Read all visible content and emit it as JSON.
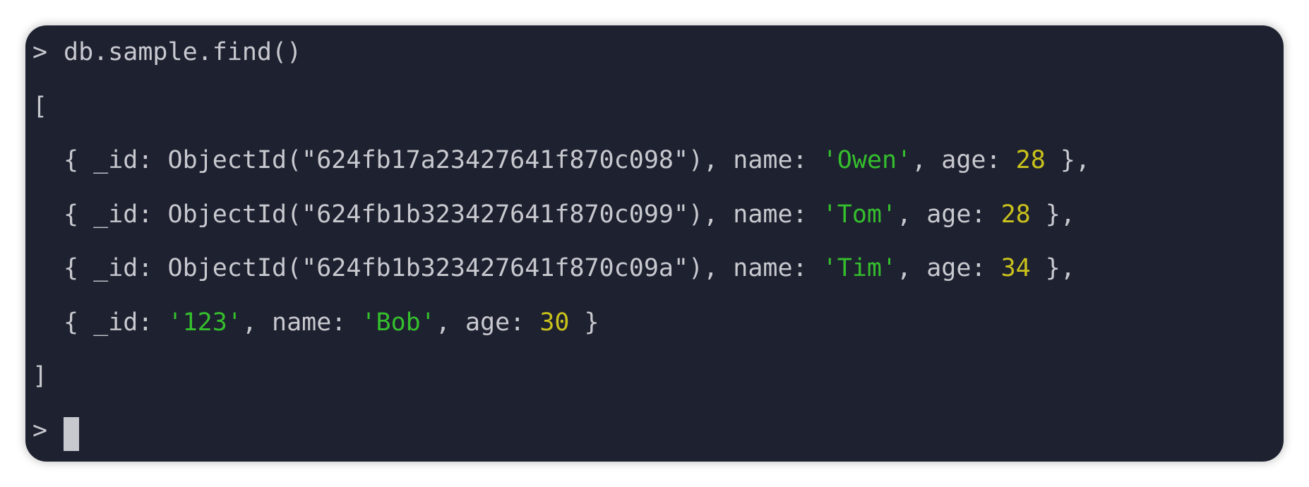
{
  "colors": {
    "background": "#1e2130",
    "text": "#c8c9cf",
    "string": "#35bf2d",
    "number": "#c9c21c"
  },
  "prompt": ">",
  "command": "db.sample.find()",
  "open_bracket": "[",
  "close_bracket": "]",
  "records": [
    {
      "open": "{ _id: ",
      "id_value": "ObjectId(\"624fb17a23427641f870c098\")",
      "id_is_string": false,
      "name_sep": ", name: ",
      "name": "'Owen'",
      "age_sep": ", age: ",
      "age": "28",
      "close": " },"
    },
    {
      "open": "{ _id: ",
      "id_value": "ObjectId(\"624fb1b323427641f870c099\")",
      "id_is_string": false,
      "name_sep": ", name: ",
      "name": "'Tom'",
      "age_sep": ", age: ",
      "age": "28",
      "close": " },"
    },
    {
      "open": "{ _id: ",
      "id_value": "ObjectId(\"624fb1b323427641f870c09a\")",
      "id_is_string": false,
      "name_sep": ", name: ",
      "name": "'Tim'",
      "age_sep": ", age: ",
      "age": "34",
      "close": " },"
    },
    {
      "open": "{ _id: ",
      "id_value": "'123'",
      "id_is_string": true,
      "name_sep": ", name: ",
      "name": "'Bob'",
      "age_sep": ", age: ",
      "age": "30",
      "close": " }"
    }
  ]
}
